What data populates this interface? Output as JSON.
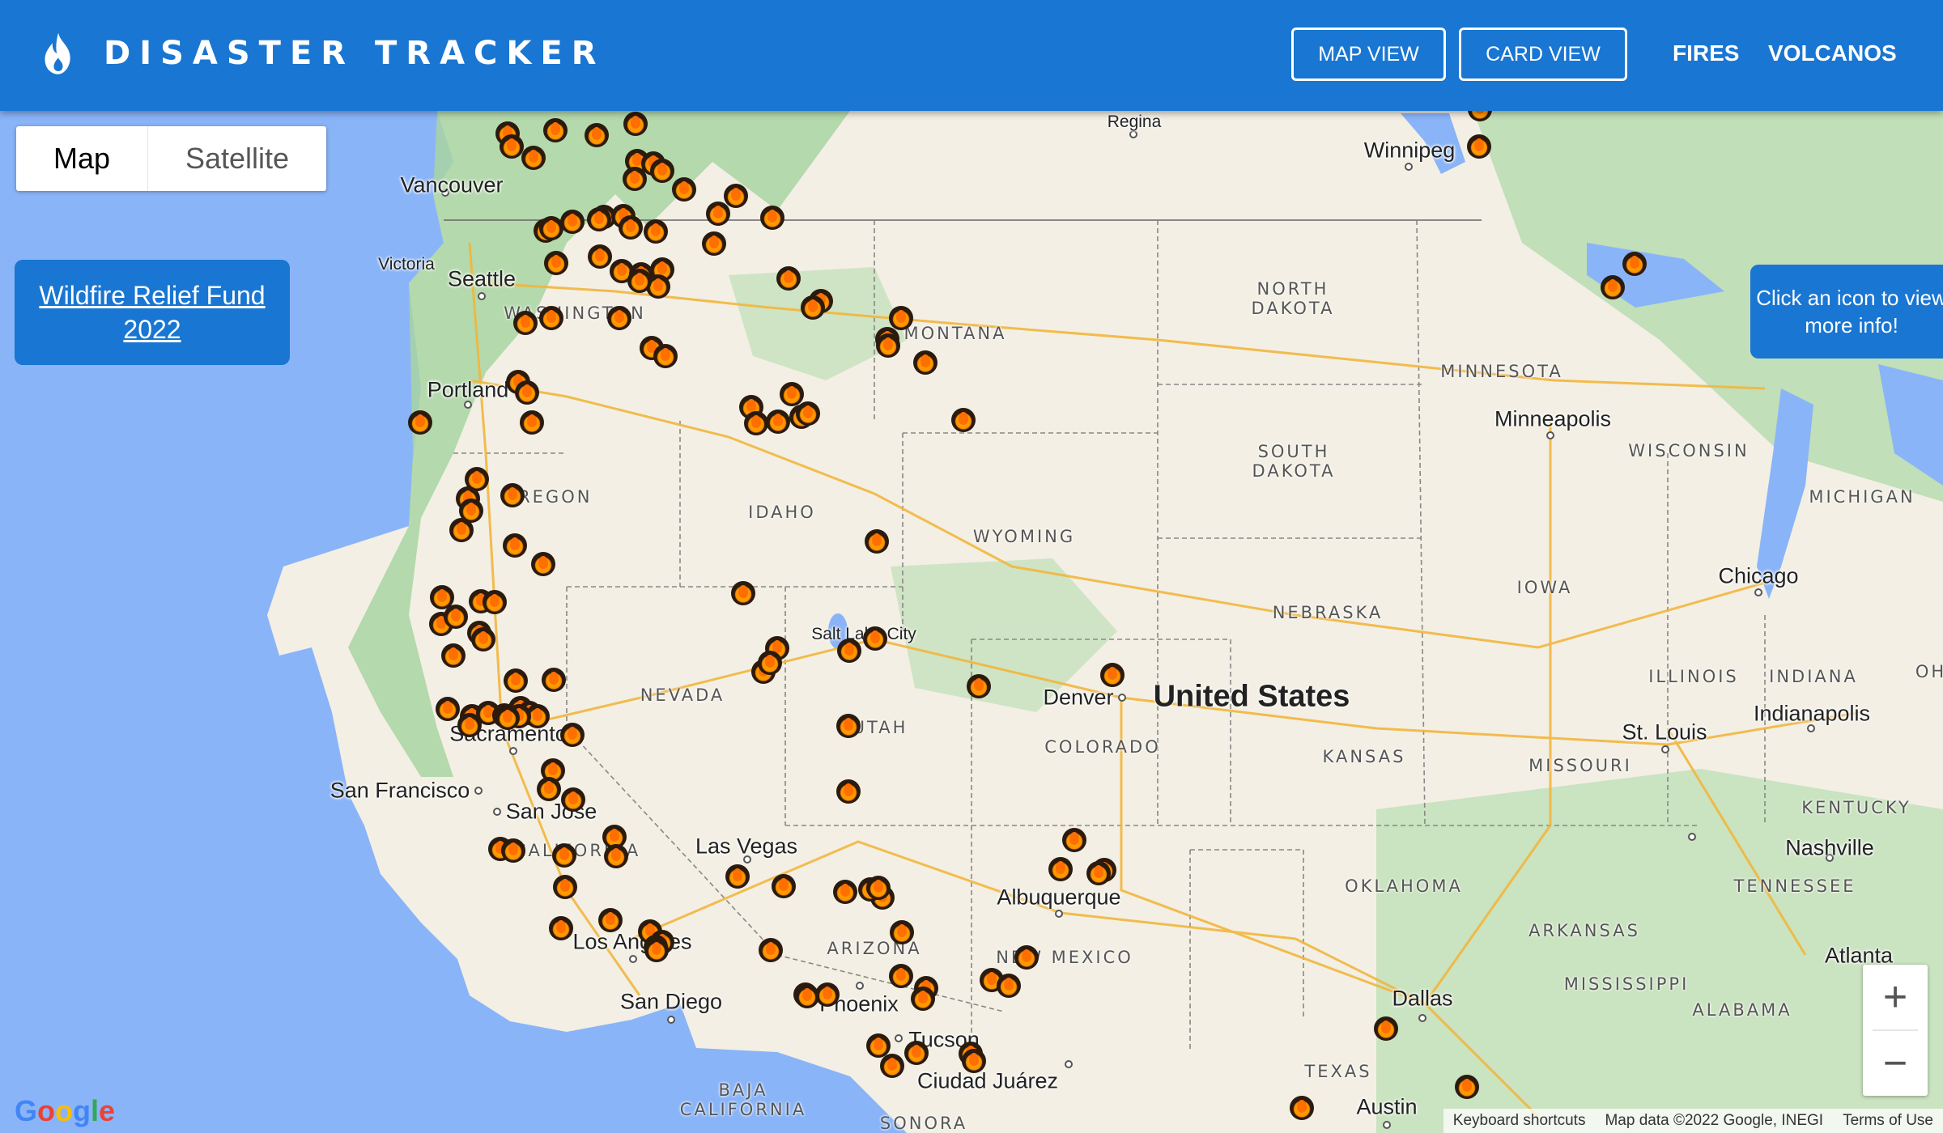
{
  "header": {
    "title": "DISASTER TRACKER",
    "logo_icon": "flame-icon",
    "map_view_label": "MAP VIEW",
    "card_view_label": "CARD VIEW",
    "fires_label": "FIRES",
    "volcanos_label": "VOLCANOS",
    "color": "#1976d2"
  },
  "map_type": {
    "map_label": "Map",
    "satellite_label": "Satellite",
    "selected": "Map"
  },
  "relief_button_label": "Wildfire Relief Fund 2022",
  "hint_text": "Click an icon to view more info!",
  "zoom": {
    "in_label": "+",
    "out_label": "−"
  },
  "attribution": {
    "google_logo": "Google",
    "keyboard": "Keyboard shortcuts",
    "data": "Map data ©2022 Google, INEGI",
    "terms": "Terms of Use"
  },
  "map_labels": {
    "cities": [
      "Regina",
      "Winnipeg",
      "Vancouver",
      "Victoria",
      "Seattle",
      "Portland",
      "Minneapolis",
      "Chicago",
      "Salt Lake City",
      "Denver",
      "Indianapolis",
      "St. Louis",
      "Nashville",
      "Sacramento",
      "San Francisco",
      "San Jose",
      "Las Vegas",
      "Albuquerque",
      "Atlanta",
      "Los Angeles",
      "Dallas",
      "San Diego",
      "Phoenix",
      "Tucson",
      "Ciudad Juárez",
      "Austin"
    ],
    "states": [
      "NORTH DAKOTA",
      "MONTANA",
      "WASHINGTON",
      "MINNESOTA",
      "SOUTH DAKOTA",
      "WISCONSIN",
      "MICHIGAN",
      "OREGON",
      "IDAHO",
      "WYOMING",
      "IOWA",
      "NEBRASKA",
      "NEVADA",
      "UTAH",
      "COLORADO",
      "KANSAS",
      "MISSOURI",
      "ILLINOIS",
      "INDIANA",
      "KENTUCKY",
      "CALIFORNIA",
      "OKLAHOMA",
      "TENNESSEE",
      "ARIZONA",
      "NEW MEXICO",
      "ARKANSAS",
      "MISSISSIPPI",
      "ALABAMA",
      "TEXAS",
      "BAJA CALIFORNIA",
      "SONORA",
      "OH"
    ],
    "country": "United States"
  },
  "colors": {
    "water": "#8ab4f8",
    "land": "#f3efe4",
    "forest": "#a8d5a2",
    "fire_marker": "#ff8f00"
  }
}
